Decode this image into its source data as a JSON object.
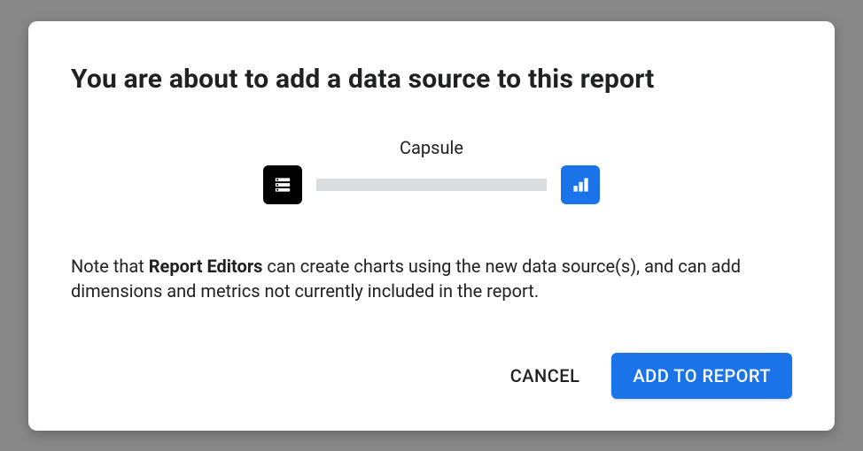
{
  "dialog": {
    "title": "You are about to add a data source to this report",
    "source_name": "Capsule",
    "note_prefix": "Note that ",
    "note_strong": "Report Editors",
    "note_suffix": " can create charts using the new data source(s), and can add dimensions and metrics not currently included in the report.",
    "cancel_label": "CANCEL",
    "confirm_label": "ADD TO REPORT"
  }
}
